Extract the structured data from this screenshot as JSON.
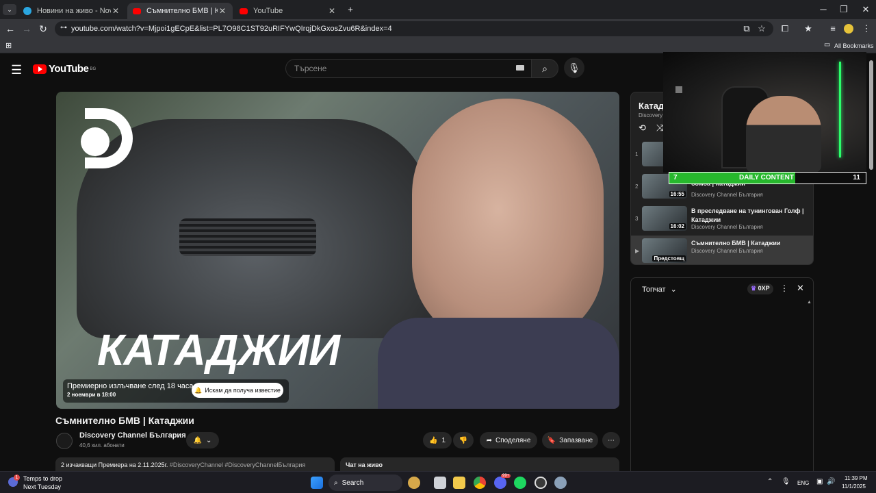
{
  "browser": {
    "tabs": [
      {
        "title": "Новини на живо - NovaPlay",
        "favicon_color": "#2aa6e0"
      },
      {
        "title": "Съмнително БМВ | Катаджии",
        "favicon_color": "#ff0000"
      },
      {
        "title": "YouTube",
        "favicon_color": "#ff0000"
      }
    ],
    "url": "youtube.com/watch?v=Mjpoi1gECpE&list=PL7O98C1ST92uRIFYwQIrqjDkGxosZvu6R&index=4",
    "bookmarks_label": "All Bookmarks"
  },
  "youtube": {
    "logo_text": "YouTube",
    "region": "BG",
    "search_placeholder": "Търсене",
    "video": {
      "overlay_title": "КАТАДЖИИ",
      "premiere_line1": "Премиерно излъчване след 18 часа",
      "premiere_line2": "2 ноември в 18:00",
      "notify_label": "Искам да получа известие",
      "title": "Съмнително БМВ | Катаджии",
      "channel": "Discovery Channel България",
      "subscribers": "40,6 хил. абонати",
      "likes": "1",
      "share_label": "Споделяне",
      "save_label": "Запазване",
      "description": "2 изчакващи  Премиера на 2.11.2025г.",
      "hashtags": "#DiscoveryChannel #DiscoveryChannelБългария",
      "chat_tab": "Чат на живо"
    },
    "playlist": {
      "title": "Катаджии",
      "owner": "Discovery",
      "items": [
        {
          "index": "1",
          "title": "",
          "channel": "",
          "duration": ""
        },
        {
          "index": "2",
          "title": "бомба | Катаджии",
          "channel": "Discovery Channel България",
          "duration": "16:55"
        },
        {
          "index": "3",
          "title": "В преследване на тунингован Голф | Катаджии",
          "channel": "Discovery Channel България",
          "duration": "16:02"
        },
        {
          "index": "▶",
          "title": "Съмнително БМВ | Катаджии",
          "channel": "Discovery Channel България",
          "duration": "Предстоящ"
        }
      ]
    },
    "chat": {
      "mode": "Топчат",
      "xp_label": "0XP"
    }
  },
  "overlay": {
    "left_value": "7",
    "label": "DAILY CONTENT",
    "right_value": "11",
    "progress": 0.64
  },
  "taskbar": {
    "notification_title": "Temps to drop",
    "notification_sub": "Next Tuesday",
    "search_label": "Search",
    "language": "ENG",
    "time": "11:39 PM",
    "date": "11/1/2025",
    "badge_count": "1",
    "discord_badge": "99+"
  }
}
